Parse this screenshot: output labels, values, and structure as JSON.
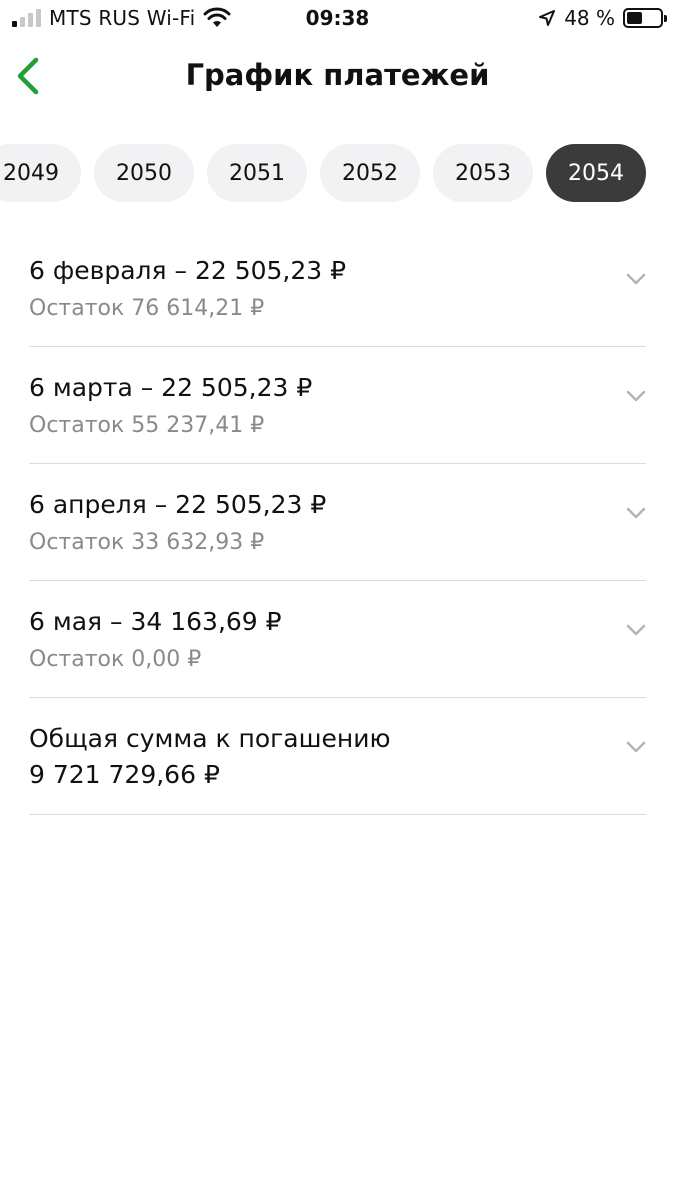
{
  "status": {
    "carrier": "MTS RUS Wi-Fi",
    "time": "09:38",
    "battery": "48 %",
    "battery_level": 0.48
  },
  "header": {
    "title": "График платежей"
  },
  "years": {
    "items": [
      "2049",
      "2050",
      "2051",
      "2052",
      "2053",
      "2054"
    ],
    "selected": "2054"
  },
  "payments": [
    {
      "title": "6 февраля – 22 505,23 ₽",
      "remaining": "Остаток 76 614,21 ₽"
    },
    {
      "title": "6 марта – 22 505,23 ₽",
      "remaining": "Остаток 55 237,41 ₽"
    },
    {
      "title": "6 апреля – 22 505,23 ₽",
      "remaining": "Остаток 33 632,93 ₽"
    },
    {
      "title": "6 мая – 34 163,69 ₽",
      "remaining": "Остаток 0,00 ₽"
    }
  ],
  "total": {
    "label": "Общая сумма к погашению",
    "value": "9 721 729,66 ₽"
  },
  "colors": {
    "accent": "#21a038",
    "chip_active": "#3b3b3c",
    "chip_bg": "#f2f2f4",
    "secondary_text": "#8a8a8e"
  }
}
